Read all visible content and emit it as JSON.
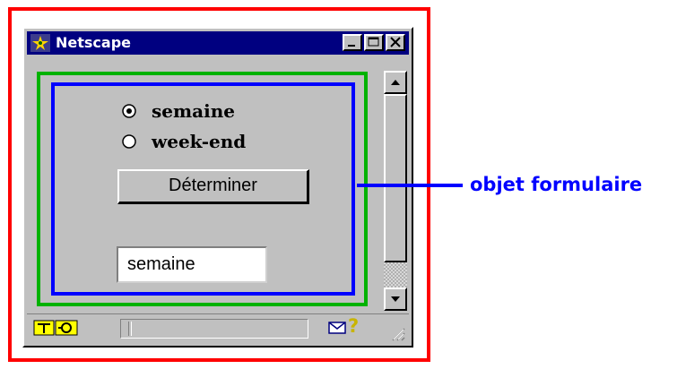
{
  "window": {
    "title": "Netscape"
  },
  "form": {
    "radio_options": [
      {
        "label": "semaine",
        "selected": true
      },
      {
        "label": "week-end",
        "selected": false
      }
    ],
    "button_label": "Déterminer",
    "text_value": "semaine"
  },
  "annotation": {
    "label": "objet formulaire"
  },
  "colors": {
    "outer_frame": "#ff0000",
    "middle_frame": "#00b200",
    "inner_frame": "#0000ff",
    "label": "#0000ff",
    "titlebar": "#000080"
  },
  "icons": {
    "title": "netscape-logo-icon",
    "minimize": "minimize-icon",
    "maximize": "maximize-icon",
    "close": "close-icon",
    "scroll_up": "scroll-up-arrow-icon",
    "scroll_down": "scroll-down-arrow-icon",
    "status_left": "security-lock-icon",
    "mail": "mail-icon",
    "help": "help-icon",
    "resize": "resize-grip-icon"
  }
}
